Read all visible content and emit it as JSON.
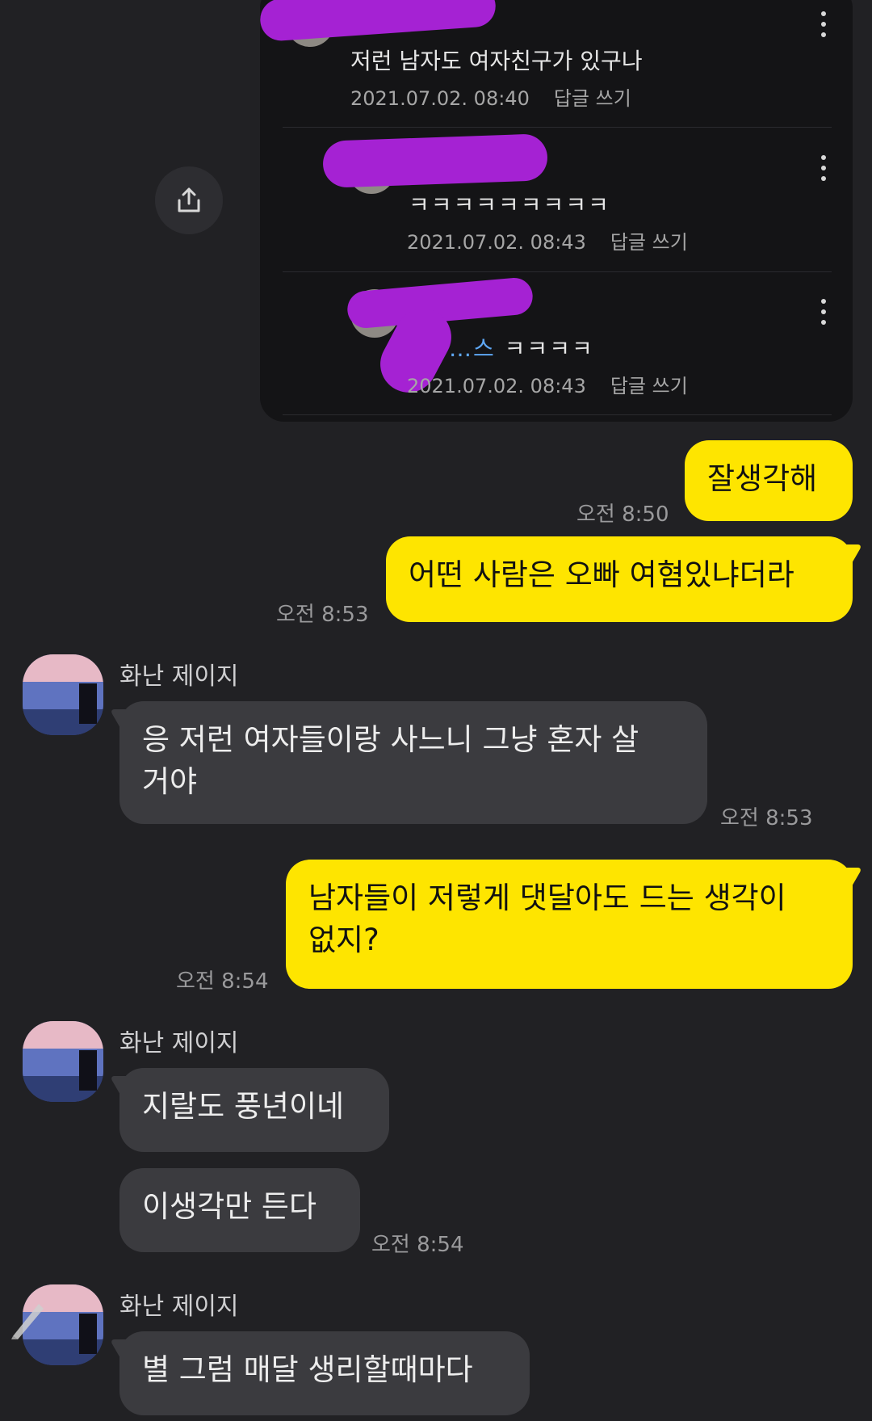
{
  "comments": [
    {
      "text": "저런 남자도  여자친구가 있구나",
      "date": "2021.07.02. 08:40",
      "reply": "답글 쓰기"
    },
    {
      "text": "ㅋㅋㅋㅋㅋㅋㅋㅋㅋ",
      "date": "2021.07.02. 08:43",
      "reply": "답글 쓰기"
    },
    {
      "mention": "…스",
      "text": "ㅋㅋㅋㅋ",
      "date": "2021.07.02. 08:43",
      "reply": "답글 쓰기"
    }
  ],
  "messages": {
    "m1": {
      "text": "잘생각해",
      "time": "오전 8:50"
    },
    "m2": {
      "text": "어떤 사람은 오빠 여혐있냐더라",
      "time": "오전 8:53"
    },
    "m3": {
      "sender": "화난 제이지",
      "line1": "응 저런 여자들이랑 사느니 그냥 혼자 살",
      "line2": "거야",
      "time": "오전 8:53"
    },
    "m4": {
      "line1": "남자들이 저렇게 댓달아도 드는 생각이",
      "line2": "없지?",
      "time": "오전 8:54"
    },
    "m5": {
      "sender": "화난 제이지",
      "text": "지랄도 풍년이네"
    },
    "m6": {
      "text": "이생각만 든다",
      "time": "오전 8:54"
    },
    "m7": {
      "sender": "화난 제이지",
      "text": "별 그럼 매달 생리할때마다"
    }
  },
  "colors": {
    "my_bubble": "#fee500",
    "their_bubble": "#3b3b3f",
    "background": "#212124",
    "redaction": "#a522d3"
  },
  "icons": {
    "share": "share-icon",
    "more": "more-vertical-icon"
  }
}
